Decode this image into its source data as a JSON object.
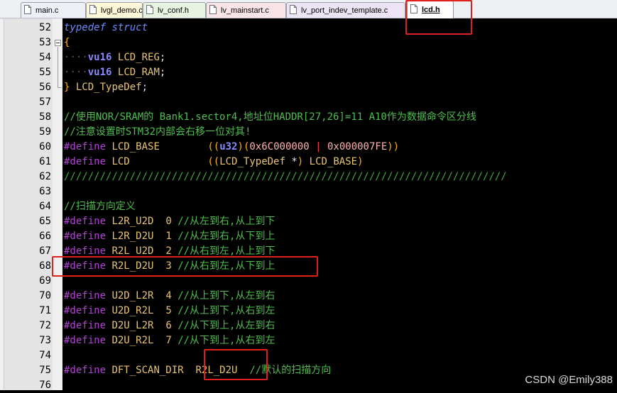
{
  "tabs": [
    {
      "label": "main.c",
      "color": "#eef0f8"
    },
    {
      "label": "lvgl_demo.c",
      "color": "#fff8d8"
    },
    {
      "label": "lv_conf.h",
      "color": "#e8f4e0"
    },
    {
      "label": "lv_mainstart.c",
      "color": "#fbe4e8"
    },
    {
      "label": "lv_port_indev_template.c",
      "color": "#ece4f4"
    },
    {
      "label": "lcd.h",
      "color": "#ffffff"
    }
  ],
  "active_tab": "lcd.h",
  "lines": [
    {
      "n": "52",
      "text": "typedef struct"
    },
    {
      "n": "53",
      "text": "{"
    },
    {
      "n": "54",
      "text": "    vu16 LCD_REG;"
    },
    {
      "n": "55",
      "text": "    vu16 LCD_RAM;"
    },
    {
      "n": "56",
      "text": "} LCD_TypeDef;"
    },
    {
      "n": "57",
      "text": ""
    },
    {
      "n": "58",
      "text": "//使用NOR/SRAM的 Bank1.sector4,地址位HADDR[27,26]=11 A10作为数据命令区分线"
    },
    {
      "n": "59",
      "text": "//注意设置时STM32内部会右移一位对其!"
    },
    {
      "n": "60",
      "text": "#define LCD_BASE        ((u32)(0x6C000000 | 0x000007FE))"
    },
    {
      "n": "61",
      "text": "#define LCD             ((LCD_TypeDef *) LCD_BASE)"
    },
    {
      "n": "62",
      "text": "//////////////////////////////////////////////////////////////////////////"
    },
    {
      "n": "63",
      "text": ""
    },
    {
      "n": "64",
      "text": "//扫描方向定义"
    },
    {
      "n": "65",
      "text": "#define L2R_U2D  0 //从左到右,从上到下"
    },
    {
      "n": "66",
      "text": "#define L2R_D2U  1 //从左到右,从下到上"
    },
    {
      "n": "67",
      "text": "#define R2L_U2D  2 //从右到左,从上到下"
    },
    {
      "n": "68",
      "text": "#define R2L_D2U  3 //从右到左,从下到上"
    },
    {
      "n": "69",
      "text": ""
    },
    {
      "n": "70",
      "text": "#define U2D_L2R  4 //从上到下,从左到右"
    },
    {
      "n": "71",
      "text": "#define U2D_R2L  5 //从上到下,从右到左"
    },
    {
      "n": "72",
      "text": "#define D2U_L2R  6 //从下到上,从左到右"
    },
    {
      "n": "73",
      "text": "#define D2U_R2L  7 //从下到上,从右到左"
    },
    {
      "n": "74",
      "text": ""
    },
    {
      "n": "75",
      "text": "#define DFT_SCAN_DIR  R2L_D2U  //默认的扫描方向"
    },
    {
      "n": "76",
      "text": ""
    }
  ],
  "watermark": "CSDN @Emily388",
  "colors": {
    "editor_bg": "#000000",
    "gutter_bg": "#e4e4e4",
    "preprocessor": "#b044d0",
    "identifier": "#e8c46e",
    "comment": "#4fbf4f",
    "keyword_italic": "#6c8cff",
    "annotation": "#e0201c"
  }
}
